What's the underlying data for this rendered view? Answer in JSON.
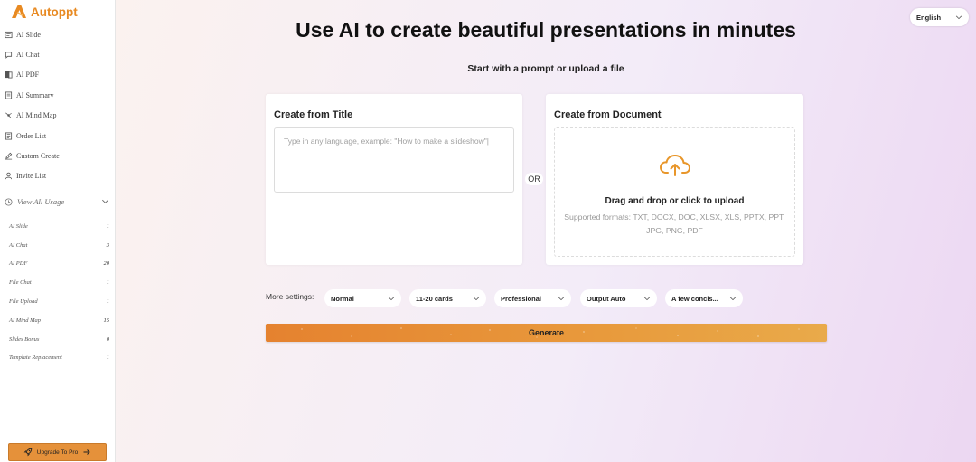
{
  "brand": {
    "name": "Autoppt",
    "accent": "#e88a22"
  },
  "sidebar": {
    "nav": [
      {
        "label": "AI Slide",
        "icon": "slide-icon"
      },
      {
        "label": "AI Chat",
        "icon": "chat-icon"
      },
      {
        "label": "AI PDF",
        "icon": "pdf-icon"
      },
      {
        "label": "AI Summary",
        "icon": "summary-icon"
      },
      {
        "label": "AI Mind Map",
        "icon": "mindmap-icon"
      },
      {
        "label": "Order List",
        "icon": "order-icon"
      },
      {
        "label": "Custom Create",
        "icon": "pen-icon"
      },
      {
        "label": "Invite List",
        "icon": "user-icon"
      }
    ],
    "usage_title": "View All Usage",
    "usage": [
      {
        "label": "AI Slide",
        "value": "1"
      },
      {
        "label": "AI Chat",
        "value": "3"
      },
      {
        "label": "AI PDF",
        "value": "20"
      },
      {
        "label": "File Chat",
        "value": "1"
      },
      {
        "label": "File Upload",
        "value": "1"
      },
      {
        "label": "AI Mind Map",
        "value": "15"
      },
      {
        "label": "Slides Bonus",
        "value": "0"
      },
      {
        "label": "Template Replacement",
        "value": "1"
      }
    ],
    "upgrade_label": "Upgrade To Pro"
  },
  "header": {
    "language": "English"
  },
  "main": {
    "headline": "Use AI to create beautiful presentations in minutes",
    "subline": "Start with a prompt or upload a file",
    "title_card": {
      "title": "Create from Title",
      "placeholder": "Type in any language, example: \"How to make a slideshow\"|"
    },
    "or_label": "OR",
    "document_card": {
      "title": "Create from Document",
      "drop_text": "Drag and drop or click to upload",
      "formats": "Supported formats: TXT, DOCX, DOC, XLSX, XLS, PPTX, PPT, JPG, PNG, PDF"
    },
    "settings_label": "More settings:",
    "settings": [
      {
        "value": "Normal"
      },
      {
        "value": "11-20 cards"
      },
      {
        "value": "Professional"
      },
      {
        "value": "Output Auto"
      },
      {
        "value": "A few concis..."
      }
    ],
    "generate_label": "Generate"
  }
}
